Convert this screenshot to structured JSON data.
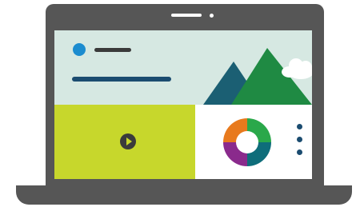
{
  "illustration": {
    "subject": "laptop",
    "colors": {
      "laptop": "#565656",
      "screen_bg": "#d6e8e2",
      "avatar": "#1c8ccf",
      "accent_navy": "#1b4c70",
      "media_panel": "#c7d72c",
      "mountain_dark": "#1b5f73",
      "mountain_green": "#1f8a43",
      "cloud": "#ffffff"
    },
    "icons": [
      "avatar-icon",
      "mountain-icon",
      "cloud-icon",
      "play-icon",
      "donut-chart-icon",
      "more-vertical-icon"
    ]
  },
  "donut": {
    "segments": [
      {
        "name": "green",
        "color": "#2aa84a",
        "fraction": 0.25
      },
      {
        "name": "teal",
        "color": "#0e6d7a",
        "fraction": 0.25
      },
      {
        "name": "purple",
        "color": "#8a2a8c",
        "fraction": 0.25
      },
      {
        "name": "orange",
        "color": "#e87a1d",
        "fraction": 0.25
      }
    ]
  }
}
